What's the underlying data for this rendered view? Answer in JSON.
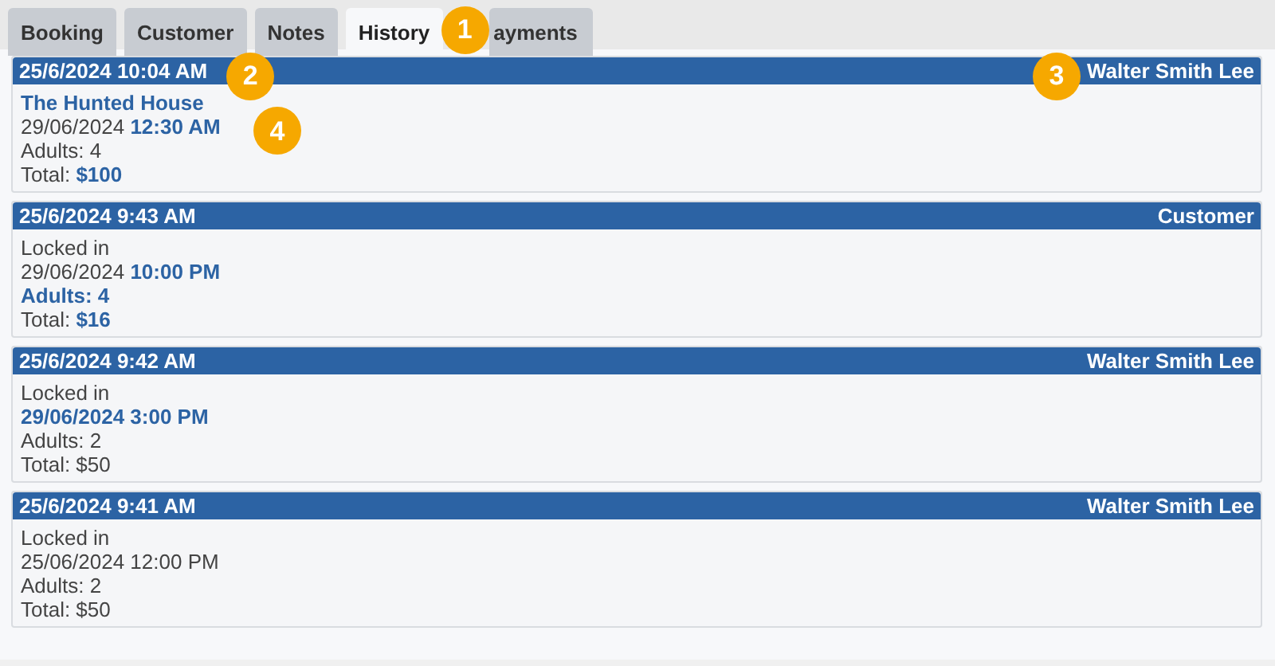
{
  "tabs": [
    {
      "label": "Booking",
      "selected": false
    },
    {
      "label": "Customer",
      "selected": false
    },
    {
      "label": "Notes",
      "selected": false
    },
    {
      "label": "History",
      "selected": true
    },
    {
      "label": "ayments",
      "selected": false,
      "callout": "1"
    }
  ],
  "entries": [
    {
      "time": "25/6/2024 10:04 AM",
      "time_callout": "2",
      "author": "Walter Smith Lee",
      "author_callout": "3",
      "lines": [
        {
          "text": "The Hunted House",
          "changed": true
        },
        {
          "text": "29/06/2024 **12:30 AM**",
          "changed": false,
          "callout": "4"
        },
        {
          "text": "Adults: 4",
          "changed": false
        },
        {
          "text": "Total: **$100**",
          "changed": false
        }
      ]
    },
    {
      "time": "25/6/2024 9:43 AM",
      "author": "Customer",
      "lines": [
        {
          "text": "Locked in",
          "changed": false
        },
        {
          "text": "29/06/2024 **10:00 PM**",
          "changed": false
        },
        {
          "text": "Adults: 4",
          "changed": true
        },
        {
          "text": "Total: **$16**",
          "changed": false
        }
      ]
    },
    {
      "time": "25/6/2024 9:42 AM",
      "author": "Walter Smith Lee",
      "lines": [
        {
          "text": "Locked in",
          "changed": false
        },
        {
          "text": "29/06/2024 3:00 PM",
          "changed": true
        },
        {
          "text": "Adults: 2",
          "changed": false
        },
        {
          "text": "Total: $50",
          "changed": false
        }
      ]
    },
    {
      "time": "25/6/2024 9:41 AM",
      "author": "Walter Smith Lee",
      "lines": [
        {
          "text": "Locked in",
          "changed": false
        },
        {
          "text": "25/06/2024 12:00 PM",
          "changed": false
        },
        {
          "text": "Adults: 2",
          "changed": false
        },
        {
          "text": "Total: $50",
          "changed": false
        }
      ]
    }
  ]
}
